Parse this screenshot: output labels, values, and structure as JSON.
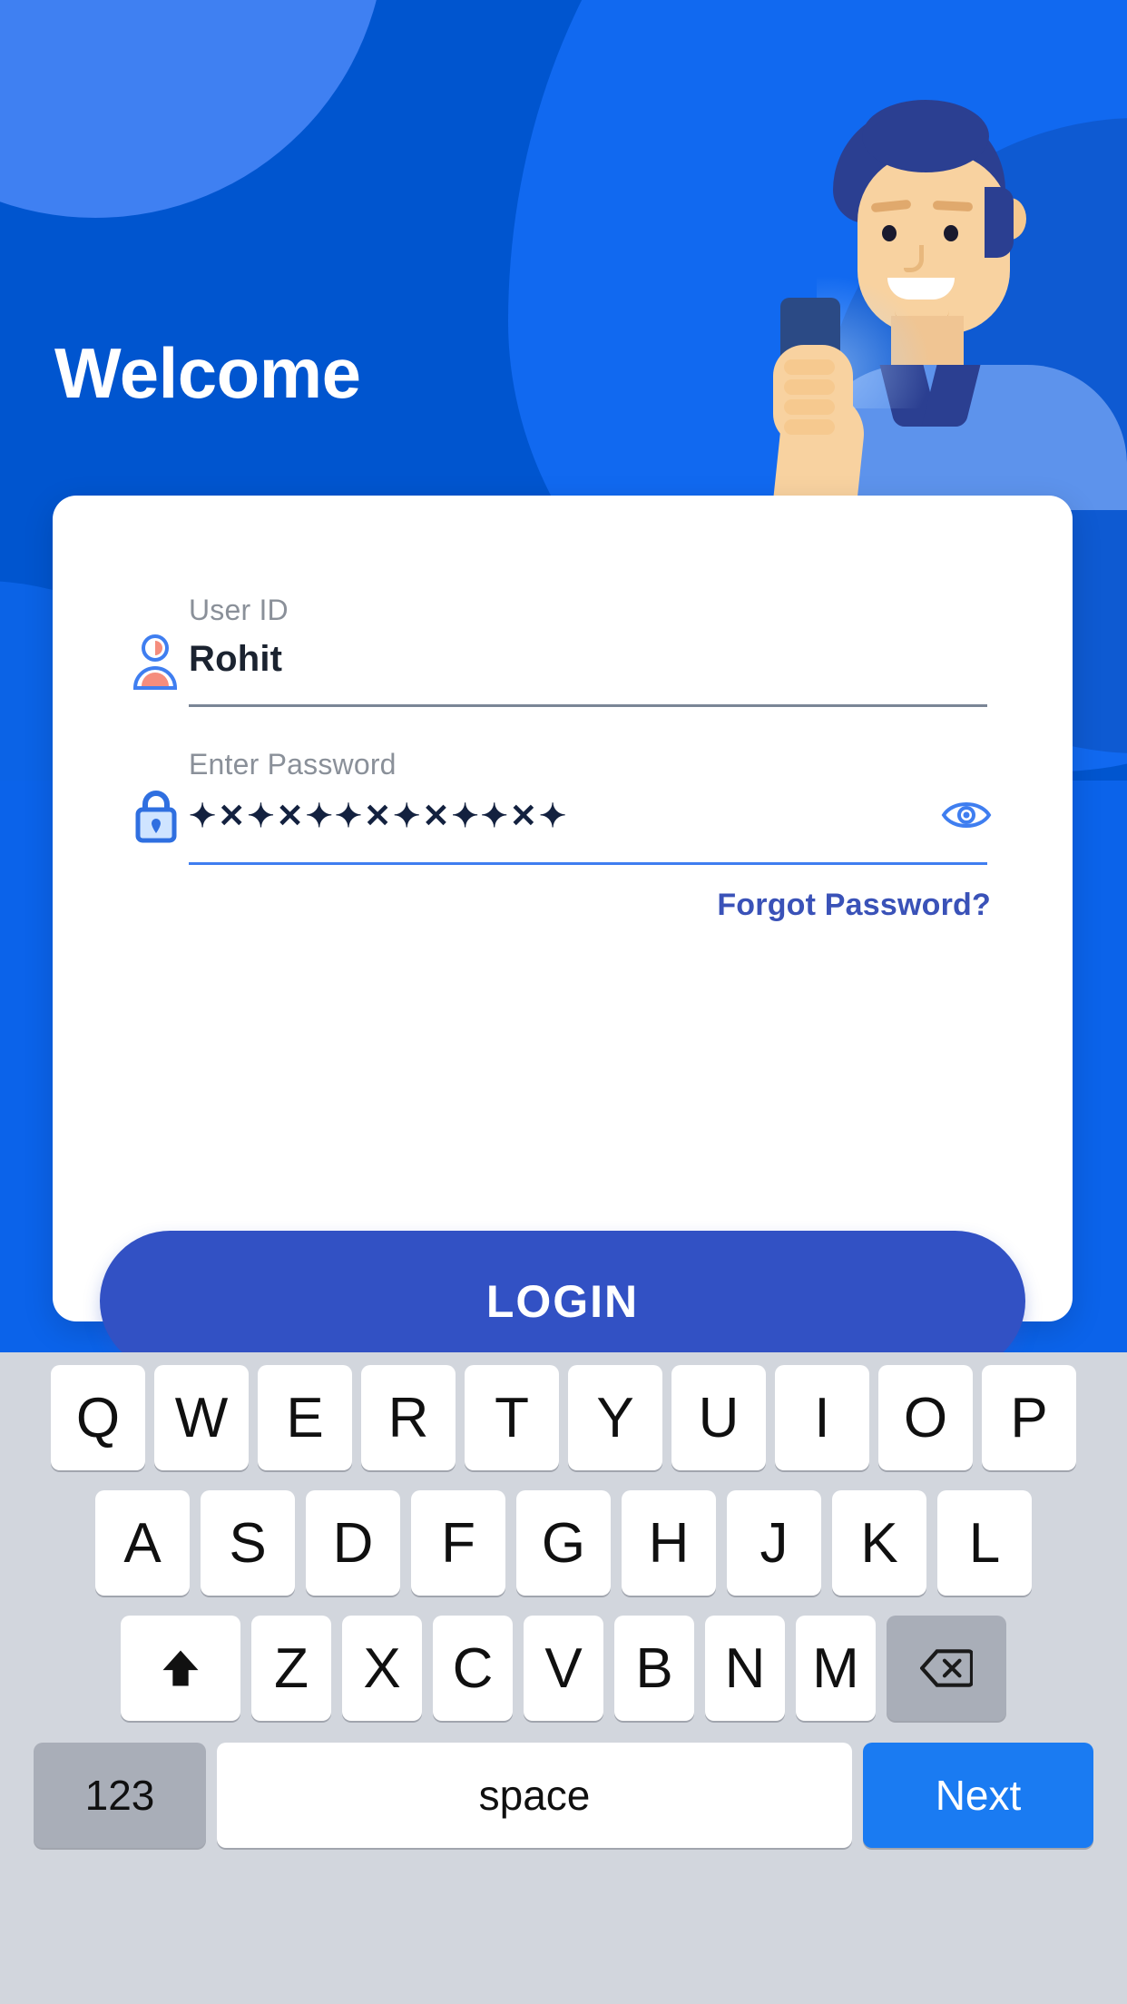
{
  "hero": {
    "title": "Welcome",
    "background_color": "#0055cf",
    "accent_light": "#3f80f2",
    "accent_mid": "#1169f0",
    "accent_dark": "#0e5ad2",
    "illustration_name": "man-holding-phone-illustration"
  },
  "form": {
    "user_field": {
      "label": "User ID",
      "value": "Rohit",
      "placeholder": "User ID",
      "icon": "person-icon",
      "underline_color": "#7a8596"
    },
    "password_field": {
      "label": "Enter Password",
      "value": "•✖✖✖✖✖✖✖✖✖✖✖✖",
      "masked_display": "✦✕✦✕✦✦✕✦✕✦✦✕✦",
      "placeholder": "Enter Password",
      "icon": "lock-icon",
      "toggle_icon": "eye-icon",
      "underline_color": "#3f7ef0"
    },
    "forgot_password_label": "Forgot Password?",
    "forgot_password_color": "#3a52b8",
    "login_button_label": "LOGIN",
    "login_button_color": "#3251c4"
  },
  "keyboard": {
    "background_color": "#d2d6dd",
    "row1": [
      "Q",
      "W",
      "E",
      "R",
      "T",
      "Y",
      "U",
      "I",
      "O",
      "P"
    ],
    "row2": [
      "A",
      "S",
      "D",
      "F",
      "G",
      "H",
      "J",
      "K",
      "L"
    ],
    "row3_letters": [
      "Z",
      "X",
      "C",
      "V",
      "B",
      "N",
      "M"
    ],
    "shift_key": "⬆",
    "backspace_key": "⌫",
    "numbers_key": "123",
    "space_key": "space",
    "next_key": "Next",
    "next_key_color": "#1a7bf2"
  }
}
